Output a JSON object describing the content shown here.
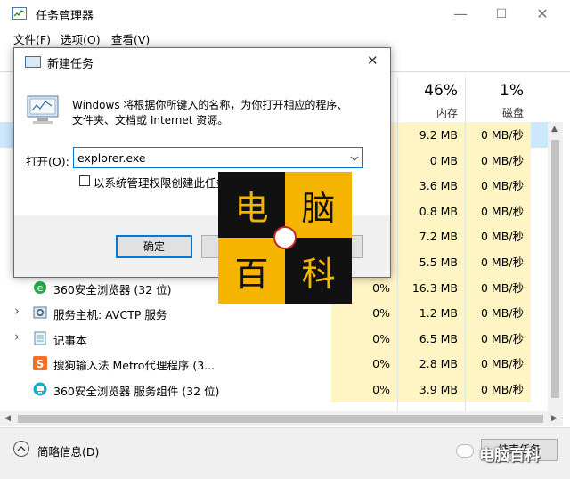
{
  "window": {
    "title": "任务管理器",
    "controls": {
      "minimize": "—",
      "maximize": "☐",
      "close": "✕"
    }
  },
  "menu": [
    "文件(F)",
    "选项(O)",
    "查看(V)"
  ],
  "columns": {
    "memory": {
      "percent": "46%",
      "label": "内存"
    },
    "disk": {
      "percent": "1%",
      "label": "磁盘"
    }
  },
  "processes": [
    {
      "name": "",
      "cpu": "",
      "memory": "9.2 MB",
      "disk": "0 MB/秒",
      "selected": true
    },
    {
      "name": "",
      "cpu": "",
      "memory": "0 MB",
      "disk": "0 MB/秒"
    },
    {
      "name": "",
      "cpu": "",
      "memory": "3.6 MB",
      "disk": "0 MB/秒"
    },
    {
      "name": "",
      "cpu": "",
      "memory": "0.8 MB",
      "disk": "0 MB/秒"
    },
    {
      "name": "",
      "cpu": "",
      "memory": "7.2 MB",
      "disk": "0 MB/秒"
    },
    {
      "name": "",
      "cpu": "",
      "memory": "5.5 MB",
      "disk": "0 MB/秒"
    },
    {
      "name": "360安全浏览器 (32 位)",
      "cpu": "0%",
      "memory": "16.3 MB",
      "disk": "0 MB/秒",
      "icon": "ie-e-icon",
      "expandable": false
    },
    {
      "name": "服务主机: AVCTP 服务",
      "cpu": "0%",
      "memory": "1.2 MB",
      "disk": "0 MB/秒",
      "icon": "gear-icon",
      "expandable": true
    },
    {
      "name": "记事本",
      "cpu": "0%",
      "memory": "6.5 MB",
      "disk": "0 MB/秒",
      "icon": "notepad-icon",
      "expandable": true
    },
    {
      "name": "搜狗输入法 Metro代理程序 (3...",
      "cpu": "0%",
      "memory": "2.8 MB",
      "disk": "0 MB/秒",
      "icon": "sogou-s-icon",
      "expandable": false
    },
    {
      "name": "360安全浏览器 服务组件 (32 位)",
      "cpu": "0%",
      "memory": "3.9 MB",
      "disk": "0 MB/秒",
      "icon": "monitor-icon",
      "expandable": false
    }
  ],
  "footer": {
    "less_details": "简略信息(D)",
    "end_task": "结束任务"
  },
  "run_dialog": {
    "title": "新建任务",
    "description_line1": "Windows 将根据你所键入的名称，为你打开相应的程序、",
    "description_line2": "文件夹、文档或 Internet 资源。",
    "open_label": "打开(O):",
    "input_value": "explorer.exe",
    "admin_checkbox_label": "以系统管理权限创建此任务",
    "admin_checked": false,
    "ok_button": "确定"
  },
  "watermark": {
    "chars": [
      "电",
      "脑",
      "百",
      "科"
    ],
    "caption": "电脑百科"
  },
  "colors": {
    "highlight_yellow": "#fff4c4",
    "selected_row": "#cce8ff",
    "accent_blue": "#0078d7",
    "logo_yellow": "#f5b400",
    "logo_black": "#111111"
  }
}
